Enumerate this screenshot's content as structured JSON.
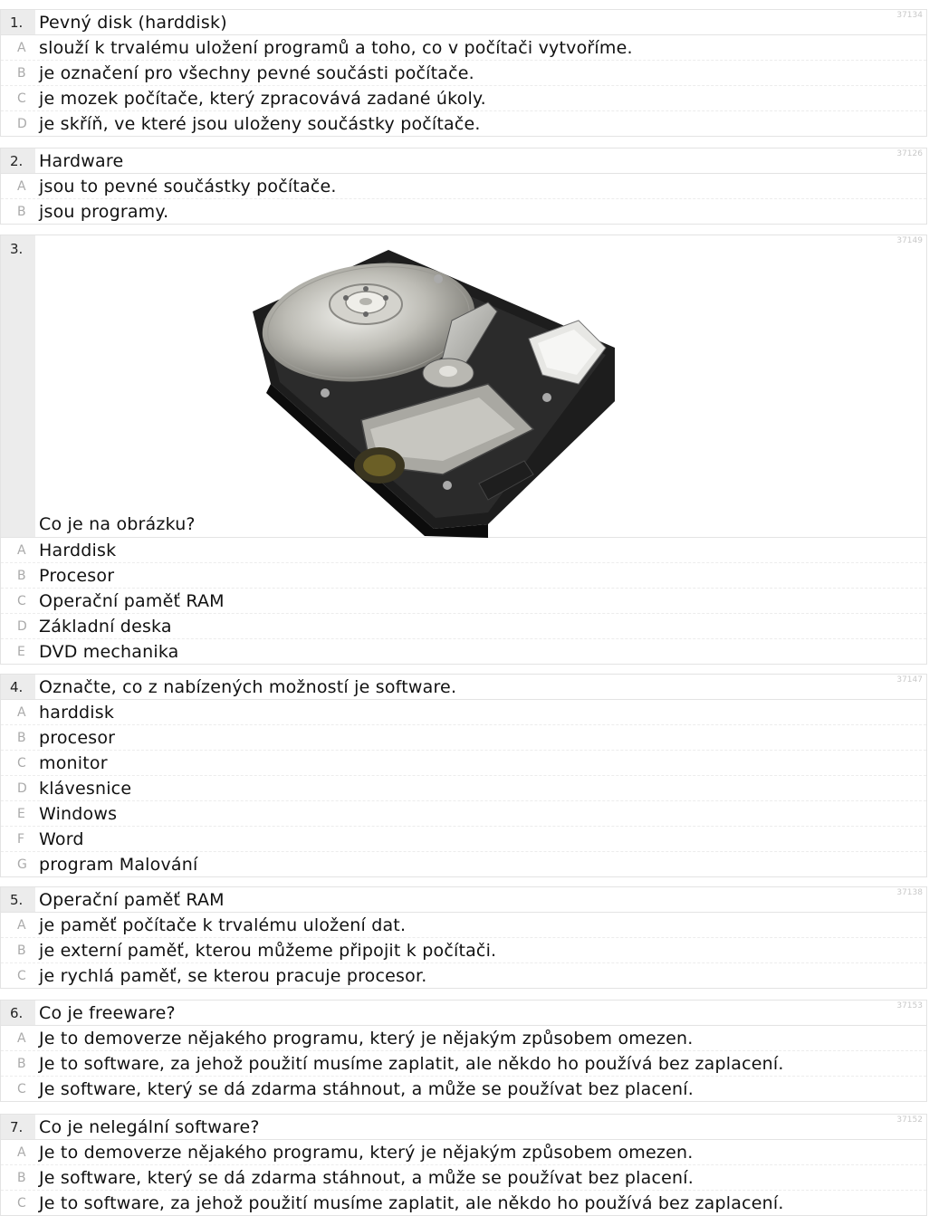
{
  "questions": [
    {
      "number": "1.",
      "text": "Pevný disk (harddisk)",
      "id": "37134",
      "options": [
        {
          "letter": "A",
          "text": "slouží k trvalému uložení programů a toho, co v počítači vytvoříme."
        },
        {
          "letter": "B",
          "text": "je označení pro všechny pevné součásti počítače."
        },
        {
          "letter": "C",
          "text": "je mozek počítače, který zpracovává zadané úkoly."
        },
        {
          "letter": "D",
          "text": "je skříň, ve které jsou uloženy součástky počítače."
        }
      ]
    },
    {
      "number": "2.",
      "text": "Hardware",
      "id": "37126",
      "options": [
        {
          "letter": "A",
          "text": "jsou to pevné součástky počítače."
        },
        {
          "letter": "B",
          "text": "jsou programy."
        }
      ]
    },
    {
      "number": "3.",
      "text": "Co je na obrázku?",
      "id": "37149",
      "options": [
        {
          "letter": "A",
          "text": "Harddisk"
        },
        {
          "letter": "B",
          "text": "Procesor"
        },
        {
          "letter": "C",
          "text": "Operační paměť RAM"
        },
        {
          "letter": "D",
          "text": "Základní deska"
        },
        {
          "letter": "E",
          "text": "DVD mechanika"
        }
      ]
    },
    {
      "number": "4.",
      "text": "Označte, co z nabízených možností je software.",
      "id": "37147",
      "options": [
        {
          "letter": "A",
          "text": "harddisk"
        },
        {
          "letter": "B",
          "text": "procesor"
        },
        {
          "letter": "C",
          "text": "monitor"
        },
        {
          "letter": "D",
          "text": "klávesnice"
        },
        {
          "letter": "E",
          "text": "Windows"
        },
        {
          "letter": "F",
          "text": "Word"
        },
        {
          "letter": "G",
          "text": "program Malování"
        }
      ]
    },
    {
      "number": "5.",
      "text": "Operační paměť RAM",
      "id": "37138",
      "options": [
        {
          "letter": "A",
          "text": "je paměť počítače k trvalému uložení dat."
        },
        {
          "letter": "B",
          "text": "je externí paměť, kterou můžeme připojit k počítači."
        },
        {
          "letter": "C",
          "text": "je rychlá paměť, se kterou pracuje procesor."
        }
      ]
    },
    {
      "number": "6.",
      "text": "Co je freeware?",
      "id": "37153",
      "options": [
        {
          "letter": "A",
          "text": "Je to demoverze nějakého programu, který je nějakým způsobem omezen."
        },
        {
          "letter": "B",
          "text": "Je to software, za jehož použití musíme zaplatit, ale někdo ho používá bez zaplacení."
        },
        {
          "letter": "C",
          "text": "Je software, který se dá zdarma stáhnout, a může se používat bez placení."
        }
      ]
    },
    {
      "number": "7.",
      "text": "Co je nelegální software?",
      "id": "37152",
      "options": [
        {
          "letter": "A",
          "text": "Je to demoverze nějakého programu, který je nějakým způsobem omezen."
        },
        {
          "letter": "B",
          "text": "Je software, který se dá zdarma stáhnout, a může se používat bez placení."
        },
        {
          "letter": "C",
          "text": "Je to software, za jehož použití musíme zaplatit, ale někdo ho používá bez zaplacení."
        }
      ]
    }
  ]
}
